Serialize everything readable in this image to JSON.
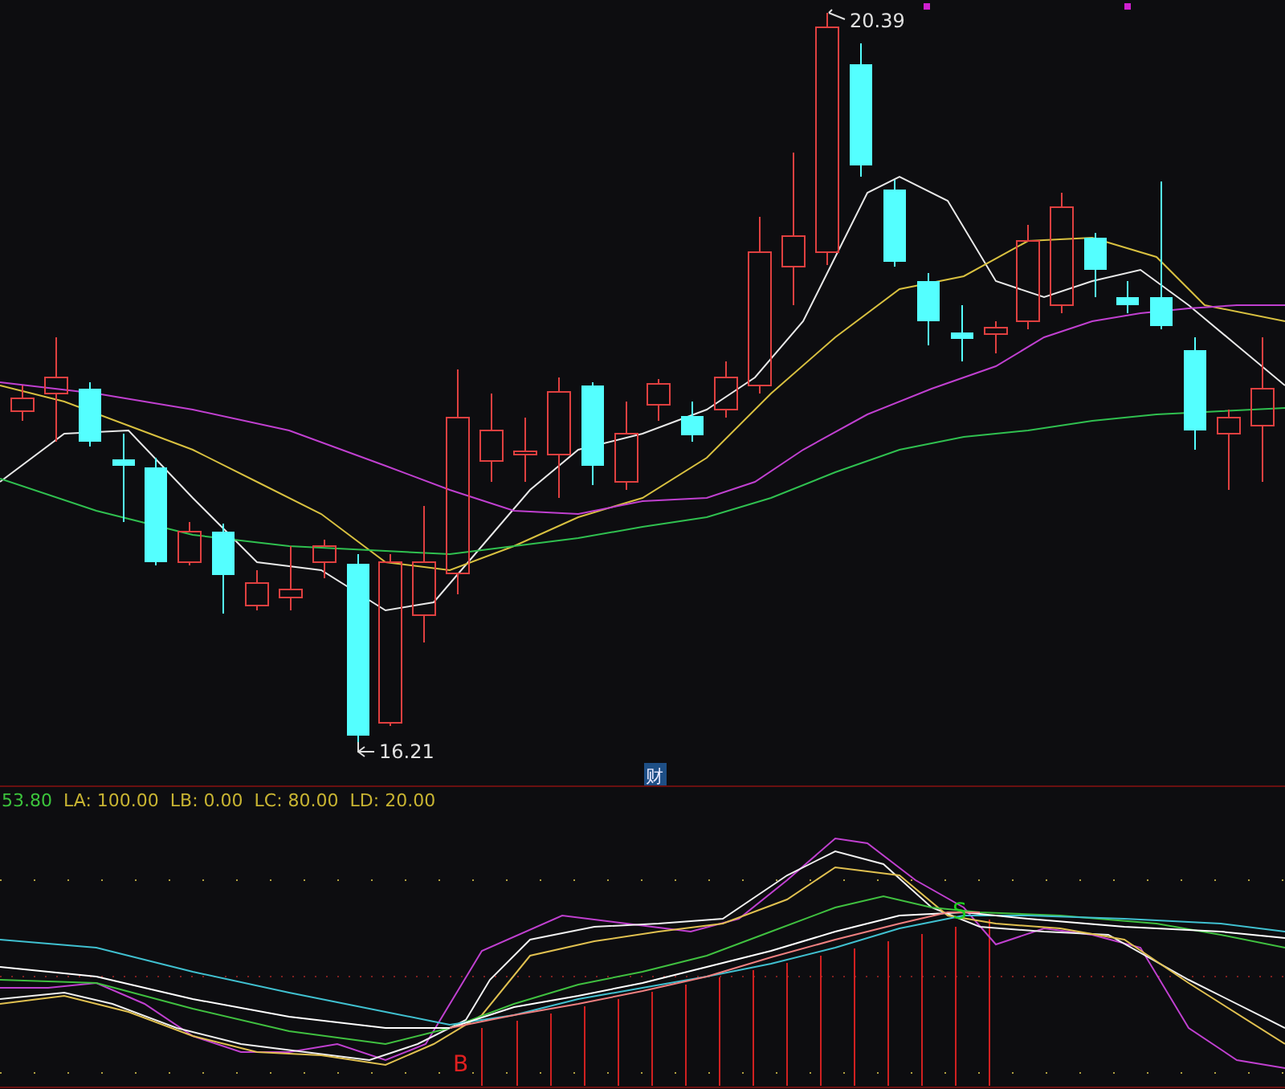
{
  "price_chart": {
    "high_label": "20.39",
    "low_label": "16.21",
    "marker": "财"
  },
  "indicator": {
    "legend": [
      {
        "text": "53.80",
        "color": "#3cc43c"
      },
      {
        "text": "LA: 100.00",
        "color": "#c8b432"
      },
      {
        "text": "LB: 0.00",
        "color": "#c8b432"
      },
      {
        "text": "LC: 80.00",
        "color": "#c8b432"
      },
      {
        "text": "LD: 20.00",
        "color": "#c8b432"
      }
    ],
    "signals": [
      {
        "text": "B",
        "kind": "buy"
      },
      {
        "text": "S",
        "kind": "sell"
      }
    ]
  }
}
